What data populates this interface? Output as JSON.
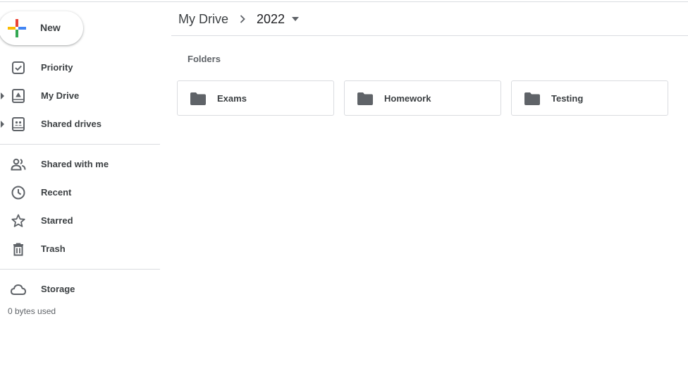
{
  "new_button": {
    "label": "New"
  },
  "sidebar": {
    "items": [
      {
        "label": "Priority",
        "icon": "priority-icon",
        "expandable": false
      },
      {
        "label": "My Drive",
        "icon": "my-drive-icon",
        "expandable": true
      },
      {
        "label": "Shared drives",
        "icon": "shared-drives-icon",
        "expandable": true
      },
      {
        "label": "Shared with me",
        "icon": "shared-with-me-icon",
        "expandable": false
      },
      {
        "label": "Recent",
        "icon": "clock-icon",
        "expandable": false
      },
      {
        "label": "Starred",
        "icon": "star-icon",
        "expandable": false
      },
      {
        "label": "Trash",
        "icon": "trash-icon",
        "expandable": false
      }
    ],
    "storage": {
      "label": "Storage",
      "icon": "cloud-icon",
      "used": "0 bytes used"
    }
  },
  "breadcrumb": {
    "root": "My Drive",
    "current": "2022"
  },
  "main": {
    "section_title": "Folders",
    "folders": [
      {
        "name": "Exams",
        "icon": "folder-icon"
      },
      {
        "name": "Homework",
        "icon": "folder-icon"
      },
      {
        "name": "Testing",
        "icon": "folder-icon"
      }
    ]
  },
  "colors": {
    "icon_gray": "#5f6368",
    "text": "#3c4043",
    "divider": "#dadce0",
    "plus_blue": "#4285f4",
    "plus_red": "#ea4335",
    "plus_yellow": "#fbbc04",
    "plus_green": "#34a853"
  }
}
